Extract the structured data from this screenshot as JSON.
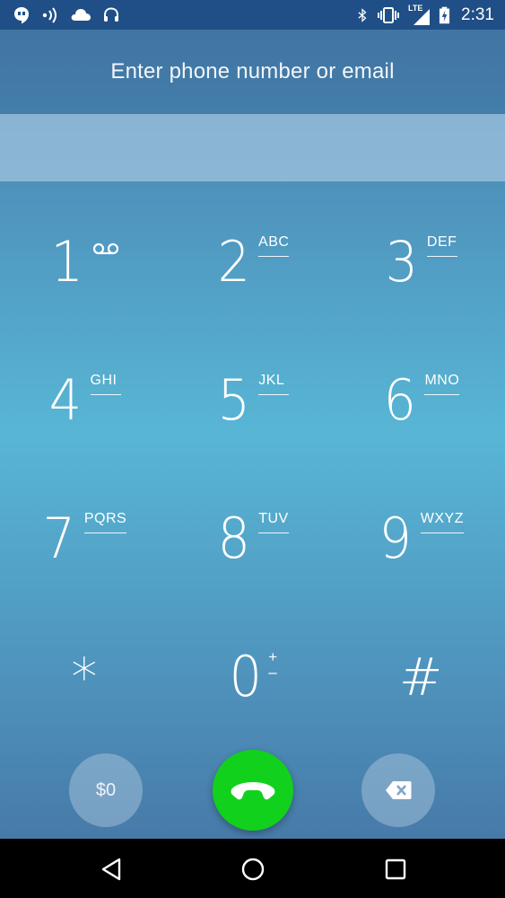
{
  "status_bar": {
    "time": "2:31",
    "network": "LTE",
    "left_icons": [
      "hangouts-icon",
      "wifi-call-icon",
      "cloud-icon",
      "headset-icon"
    ],
    "right_icons": [
      "bluetooth-icon",
      "vibrate-icon",
      "signal-icon",
      "battery-charging-icon"
    ]
  },
  "header": {
    "title": "Enter phone number or email"
  },
  "number_field": {
    "value": "",
    "placeholder": ""
  },
  "keypad": {
    "keys": [
      {
        "digit": "1",
        "letters": ""
      },
      {
        "digit": "2",
        "letters": "ABC"
      },
      {
        "digit": "3",
        "letters": "DEF"
      },
      {
        "digit": "4",
        "letters": "GHI"
      },
      {
        "digit": "5",
        "letters": "JKL"
      },
      {
        "digit": "6",
        "letters": "MNO"
      },
      {
        "digit": "7",
        "letters": "PQRS"
      },
      {
        "digit": "8",
        "letters": "TUV"
      },
      {
        "digit": "9",
        "letters": "WXYZ"
      },
      {
        "digit": "*",
        "letters": ""
      },
      {
        "digit": "0",
        "plus": "+",
        "minus": "–"
      },
      {
        "digit": "#",
        "letters": ""
      }
    ]
  },
  "actions": {
    "credit_label": "$0"
  },
  "colors": {
    "status_bar": "#1f4f86",
    "call_button": "#12d11c",
    "gradient_mid": "#58b6d5"
  }
}
